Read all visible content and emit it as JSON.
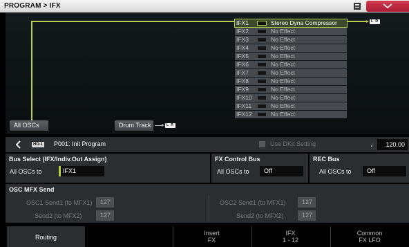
{
  "titlebar": {
    "title": "PROGRAM > IFX",
    "menu_icon": "list-icon",
    "dropdown_icon": "chevron-down-icon"
  },
  "routing": {
    "output_label": "L R",
    "ifx": [
      {
        "label": "IFX1",
        "effect": "Stereo Dyna Compressor",
        "active": true
      },
      {
        "label": "IFX2",
        "effect": "No Effect",
        "active": false
      },
      {
        "label": "IFX3",
        "effect": "No Effect",
        "active": false
      },
      {
        "label": "IFX4",
        "effect": "No Effect",
        "active": false
      },
      {
        "label": "IFX5",
        "effect": "No Effect",
        "active": false
      },
      {
        "label": "IFX6",
        "effect": "No Effect",
        "active": false
      },
      {
        "label": "IFX7",
        "effect": "No Effect",
        "active": false
      },
      {
        "label": "IFX8",
        "effect": "No Effect",
        "active": false
      },
      {
        "label": "IFX9",
        "effect": "No Effect",
        "active": false
      },
      {
        "label": "IFX10",
        "effect": "No Effect",
        "active": false
      },
      {
        "label": "IFX11",
        "effect": "No Effect",
        "active": false
      },
      {
        "label": "IFX12",
        "effect": "No Effect",
        "active": false
      }
    ],
    "all_oscs_label": "All OSCs",
    "drum_track_label": "Drum Track",
    "drum_output": "L R"
  },
  "program": {
    "bank_badge": "HD-1",
    "name": "P001: Init Program",
    "use_dkit": "Use DKit Setting",
    "tempo": "120.00",
    "tempo_icon": "♩"
  },
  "bus_select": {
    "header": "Bus Select (IFX/Indiv.Out Assign)",
    "label": "All OSCs to",
    "value": "IFX1"
  },
  "fx_control_bus": {
    "header": "FX Control Bus",
    "label": "All OSCs to",
    "value": "Off"
  },
  "rec_bus": {
    "header": "REC Bus",
    "label": "All OSCs to",
    "value": "Off"
  },
  "mfx_send": {
    "header": "OSC MFX Send",
    "osc1_send1_label": "OSC1 Send1 (to MFX1)",
    "osc1_send1": "127",
    "osc1_send2_label": "Send2 (to MFX2)",
    "osc1_send2": "127",
    "osc2_send1_label": "OSC2 Send1 (to MFX1)",
    "osc2_send1": "127",
    "osc2_send2_label": "Send2 (to MFX2)",
    "osc2_send2": "127"
  },
  "tabs": [
    {
      "line1": "Routing",
      "line2": "",
      "active": true
    },
    {
      "line1": "Insert",
      "line2": "FX",
      "active": false
    },
    {
      "line1": "IFX",
      "line2": "1 - 12",
      "active": false
    },
    {
      "line1": "Common",
      "line2": "FX LFO",
      "active": false
    }
  ],
  "colors": {
    "accent": "#b8cf4a",
    "title_dropdown": "#c0273f"
  }
}
